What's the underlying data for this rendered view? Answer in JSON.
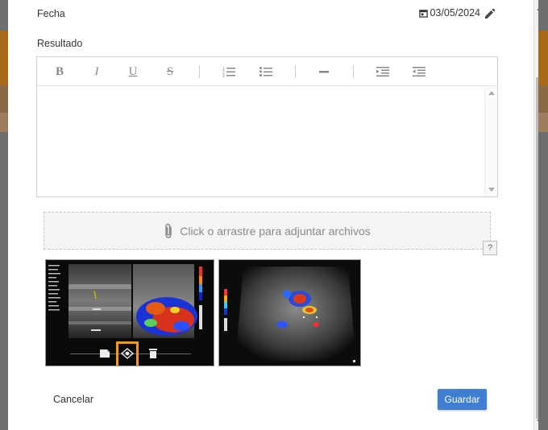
{
  "form": {
    "fecha_label": "Fecha",
    "fecha_value": "03/05/2024",
    "resultado_label": "Resultado"
  },
  "editor": {
    "toolbar": [
      {
        "name": "bold",
        "glyph": "B"
      },
      {
        "name": "italic",
        "glyph": "I"
      },
      {
        "name": "underline",
        "glyph": "U"
      },
      {
        "name": "strikethrough",
        "glyph": "S"
      },
      {
        "name": "ordered-list",
        "icon": "ordered-list-icon"
      },
      {
        "name": "unordered-list",
        "icon": "unordered-list-icon"
      },
      {
        "name": "horizontal-rule",
        "icon": "horizontal-rule-icon"
      },
      {
        "name": "indent",
        "icon": "indent-icon"
      },
      {
        "name": "outdent",
        "icon": "outdent-icon"
      }
    ],
    "content": ""
  },
  "upload": {
    "dropzone_text": "Click o arrastre para adjuntar archivos",
    "help_label": "?"
  },
  "attachments": [
    {
      "type": "ultrasound-image",
      "actions": [
        "edit-icon",
        "view-icon",
        "delete-icon"
      ],
      "highlighted_action": "view-icon"
    },
    {
      "type": "ultrasound-image"
    }
  ],
  "actions": {
    "cancel_label": "Cancelar",
    "save_label": "Guardar"
  },
  "colors": {
    "accent": "#3f7fd2",
    "highlight": "#f39c12"
  }
}
